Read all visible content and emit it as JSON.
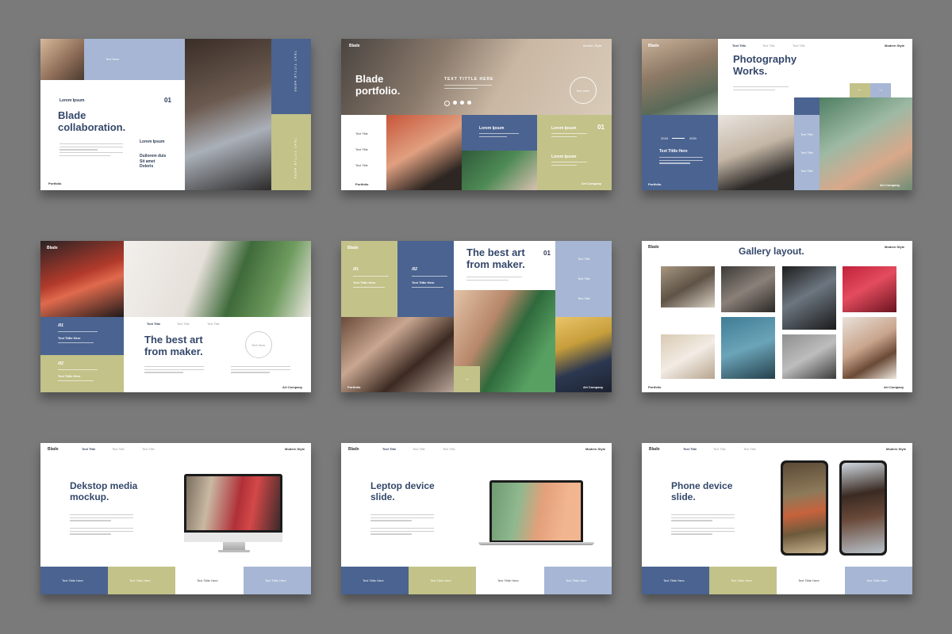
{
  "s1": {
    "box_text": "Text Here",
    "lorem_label": "Lorem Ipsum",
    "number": "01",
    "title_line1": "Blade",
    "title_line2": "collaboration.",
    "side_heading": "Lorem Ipsum",
    "side_text_line1": "Duilorem duis",
    "side_text_line2": "Sit amet",
    "side_text_line3": "Doloris",
    "footer": "Portfolio",
    "vertical_text_1": "TEXT TITTLE HERE",
    "vertical_text_2": "TEXT TITTLE HERE"
  },
  "s2": {
    "brand": "Blade",
    "style": "Modern Style",
    "title_line1": "Blade",
    "title_line2": "portfolio.",
    "headline": "TEXT TITTLE HERE",
    "circle_label": "Text Here",
    "text_title_1": "Text Title",
    "text_title_2": "Text Title",
    "text_title_3": "Text Title",
    "lorem_1": "Lorem Ipsum",
    "lorem_2": "Lorem Ipsum",
    "lorem_3": "Lorem Ipsum",
    "number": "01",
    "footer_left": "Portfolio",
    "footer_right": "Art Company"
  },
  "s3": {
    "brand": "Blade",
    "nav_1": "Text Title",
    "nav_2": "Text Title",
    "nav_3": "Text Title",
    "style": "Modern Style",
    "title_line1": "Photography",
    "title_line2": "Works.",
    "year_1": "2018",
    "year_2": "2020",
    "text_title": "Text Tittle Here",
    "side_1": "Text Title",
    "side_2": "Text Title",
    "side_3": "Text Title",
    "footer_left": "Portfolio",
    "footer_right": "Art Company"
  },
  "s4": {
    "brand": "Blade",
    "nav_1": "Text Title",
    "nav_2": "Text Title",
    "nav_3": "Text Title",
    "quote_1": "/01",
    "text_title_1": "Text Tittle Here",
    "quote_2": "/02",
    "text_title_2": "Text Tittle Here",
    "title_line1": "The best art",
    "title_line2": "from maker.",
    "circle_label": "Text Here",
    "footer_right": "Art Company"
  },
  "s5": {
    "brand": "Blade",
    "quote_1": "/01",
    "text_title_1": "Text Tittle Here",
    "quote_2": "/02",
    "text_title_2": "Text Tittle Here",
    "title_line1": "The best art",
    "title_line2": "from maker.",
    "number": "01",
    "side_1": "Text Title",
    "side_2": "Text Title",
    "side_3": "Text Title",
    "footer_left": "Portfolio",
    "footer_right": "Art Company"
  },
  "s6": {
    "brand": "Blade",
    "style": "Modern Style",
    "title": "Gallery layout.",
    "footer_left": "Portfolio",
    "footer_right": "Art Company"
  },
  "s7": {
    "brand": "Blade",
    "nav_1": "Text Title",
    "nav_2": "Text Title",
    "nav_3": "Text Title",
    "style": "Modern Style",
    "title_line1": "Dekstop media",
    "title_line2": "mockup.",
    "box_1": "Text Tittle Here",
    "box_2": "Text Tittle Here",
    "box_3": "Text Tittle Here",
    "box_4": "Text Tittle Here"
  },
  "s8": {
    "brand": "Blade",
    "nav_1": "Text Title",
    "nav_2": "Text Title",
    "nav_3": "Text Title",
    "style": "Modern Style",
    "title_line1": "Leptop device",
    "title_line2": "slide.",
    "box_1": "Text Tittle Here",
    "box_2": "Text Tittle Here",
    "box_3": "Text Tittle Here",
    "box_4": "Text Tittle Here"
  },
  "s9": {
    "brand": "Blade",
    "nav_1": "Text Title",
    "nav_2": "Text Title",
    "nav_3": "Text Title",
    "style": "Modern Style",
    "title_line1": "Phone device",
    "title_line2": "slide.",
    "box_1": "Text Tittle Here",
    "box_2": "Text Tittle Here",
    "box_3": "Text Tittle Here",
    "box_4": "Text Tittle Here"
  },
  "colors": {
    "background": "#7a7a7a",
    "navy": "#4a6390",
    "olive": "#c2c289",
    "light_blue": "#a6b6d4",
    "title_text": "#34486b"
  }
}
